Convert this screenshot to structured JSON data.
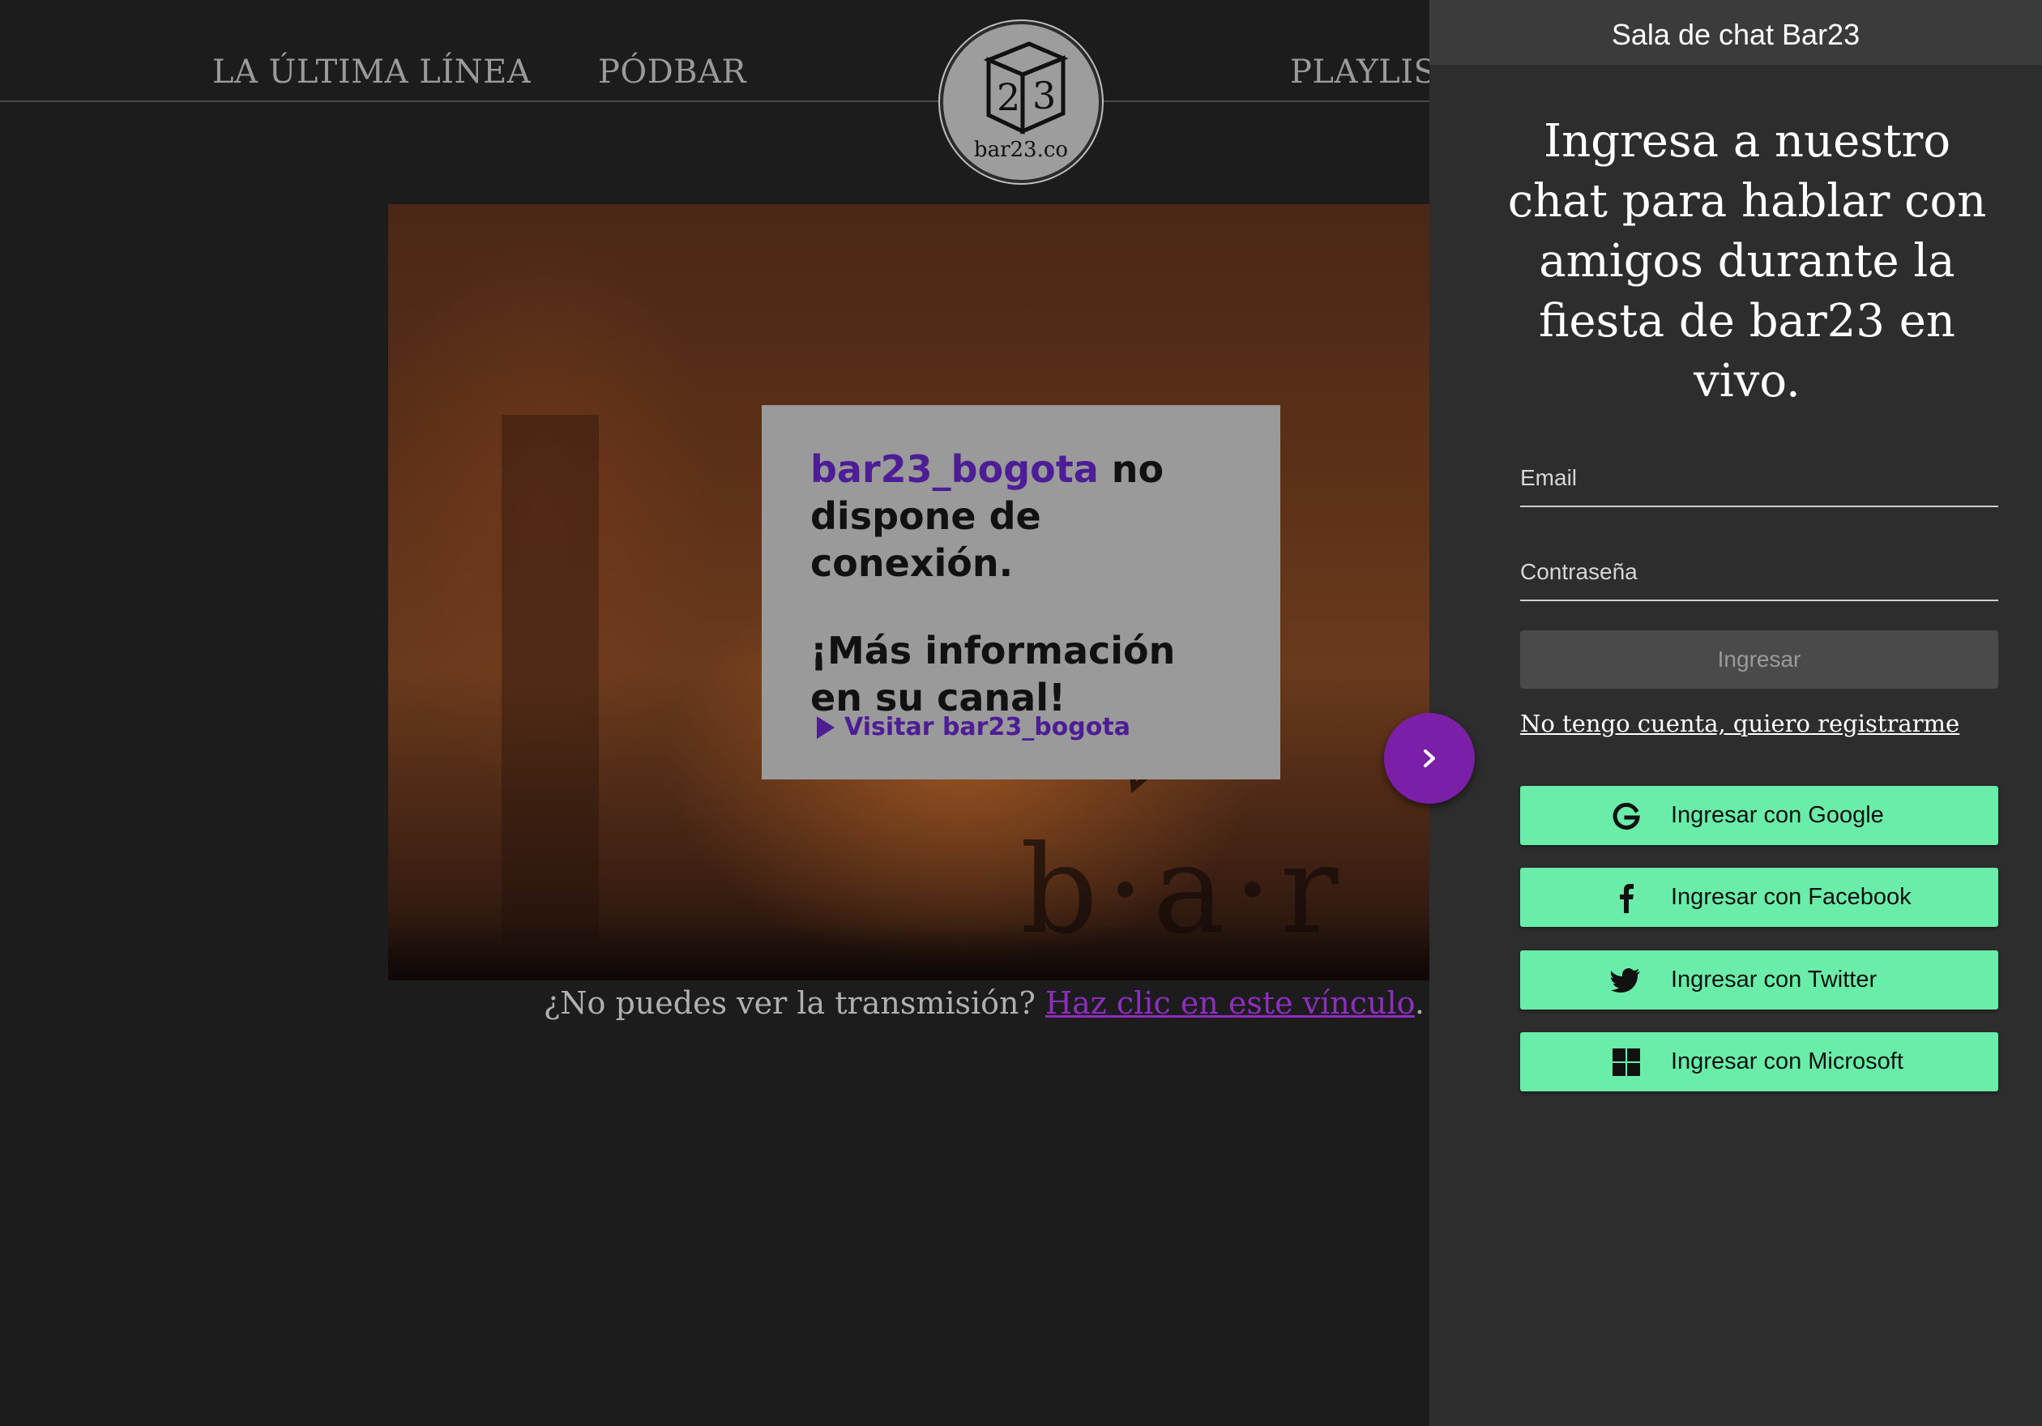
{
  "nav": {
    "links": [
      "LA ÚLTIMA LÍNEA",
      "PÓDBAR",
      "PLAYLIST"
    ],
    "logo_text": "bar23.co"
  },
  "video": {
    "watermark_text": "b·a·r",
    "offline_card": {
      "channel": "bar23_bogota",
      "line1_rest": " no dispone de conexión.",
      "line2": "¡Más información en su canal!",
      "visit_label": "Visitar bar23_bogota"
    }
  },
  "stream_help": {
    "text": "¿No puedes ver la transmisión? ",
    "link": "Haz clic en este vínculo",
    "suffix": "."
  },
  "chat": {
    "title": "Sala de chat Bar23",
    "intro": "Ingresa a nuestro chat para hablar con amigos durante la fiesta de bar23 en vivo.",
    "email_label": "Email",
    "password_label": "Contraseña",
    "login_button": "Ingresar",
    "register_link": "No tengo cuenta, quiero registrarme",
    "social": {
      "google": "Ingresar con Google",
      "facebook": "Ingresar con Facebook",
      "twitter": "Ingresar con Twitter",
      "microsoft": "Ingresar con Microsoft"
    }
  },
  "colors": {
    "accent_purple": "#7c1fa8",
    "channel_purple": "#4c1d95",
    "social_green": "#69eda9",
    "panel_bg": "#2d2d2e"
  }
}
